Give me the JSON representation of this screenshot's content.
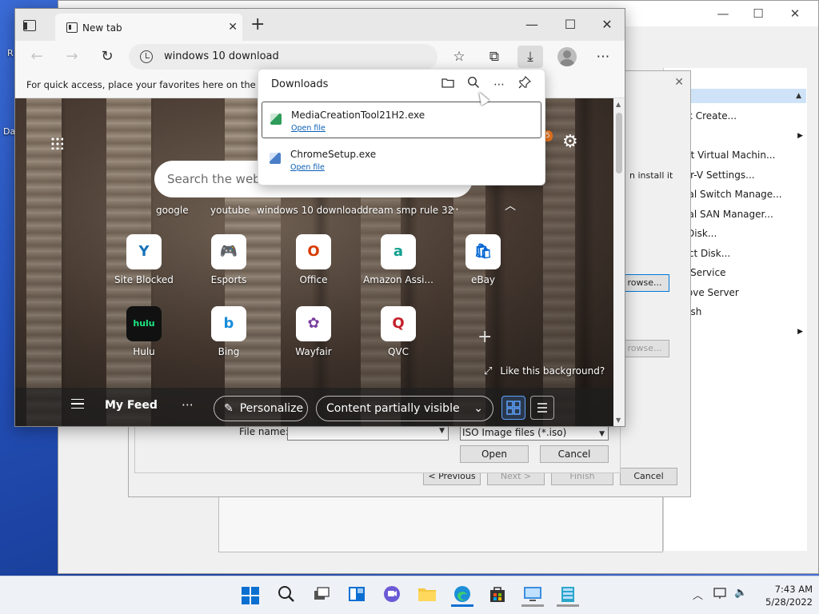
{
  "desktop": {
    "fragment_top": "R",
    "fragment_mid": "Da"
  },
  "hyperv": {
    "actions_header": "ns",
    "actions": [
      {
        "label": "Quick Create...",
        "submenu": false
      },
      {
        "label": "New",
        "submenu": true
      },
      {
        "label": "mport Virtual Machin...",
        "submenu": false
      },
      {
        "label": "Hyper-V Settings...",
        "submenu": false
      },
      {
        "label": "Virtual Switch Manage...",
        "submenu": false
      },
      {
        "label": "Virtual SAN Manager...",
        "submenu": false
      },
      {
        "label": "Edit Disk...",
        "submenu": false
      },
      {
        "label": "nspect Disk...",
        "submenu": false
      },
      {
        "label": "Stop Service",
        "submenu": false
      },
      {
        "label": "Remove Server",
        "submenu": false
      },
      {
        "label": "Refresh",
        "submenu": false
      },
      {
        "label": "View",
        "submenu": true
      },
      {
        "label": "Help",
        "submenu": false
      }
    ]
  },
  "wizard": {
    "install_text": "n install it",
    "browse1": "rowse...",
    "browse2": "rowse...",
    "prev": "< Previous",
    "next": "Next >",
    "finish": "Finish",
    "cancel": "Cancel"
  },
  "file_dialog": {
    "file_name_label": "File name:",
    "file_type": "ISO Image files   (*.iso)",
    "open": "Open",
    "cancel": "Cancel"
  },
  "browser": {
    "tab_title": "New tab",
    "address": "windows 10 download",
    "favorites_hint": "For quick access, place your favorites here on the favo",
    "ntp": {
      "search_placeholder": "Search the web",
      "notif_count": "5",
      "quick_links": [
        "google",
        "youtube",
        "windows 10 download",
        "dream smp rule 32"
      ],
      "tiles_row1": [
        {
          "label": "Site Blocked",
          "glyph": "Y",
          "color": "#1a73b8"
        },
        {
          "label": "Esports",
          "glyph": "🎮",
          "color": "#e0245e"
        },
        {
          "label": "Office",
          "glyph": "O",
          "color": "#d83b01"
        },
        {
          "label": "Amazon Assi...",
          "glyph": "a",
          "color": "#12a08f"
        },
        {
          "label": "eBay",
          "glyph": "🛍",
          "color": "#0064d2"
        }
      ],
      "tiles_row2": [
        {
          "label": "Hulu",
          "glyph": "hulu",
          "color": "#1ce783"
        },
        {
          "label": "Bing",
          "glyph": "b",
          "color": "#1a8dd8"
        },
        {
          "label": "Wayfair",
          "glyph": "✿",
          "color": "#7b3fa0"
        },
        {
          "label": "QVC",
          "glyph": "Q",
          "color": "#c4202b"
        }
      ],
      "like_background": "Like this background?",
      "feed_title": "My Feed",
      "personalize": "Personalize",
      "content_visibility": "Content partially visible"
    }
  },
  "downloads": {
    "title": "Downloads",
    "items": [
      {
        "name": "MediaCreationTool21H2.exe",
        "action": "Open file"
      },
      {
        "name": "ChromeSetup.exe",
        "action": "Open file"
      }
    ]
  },
  "taskbar": {
    "time": "7:43 AM",
    "date": "5/28/2022"
  }
}
